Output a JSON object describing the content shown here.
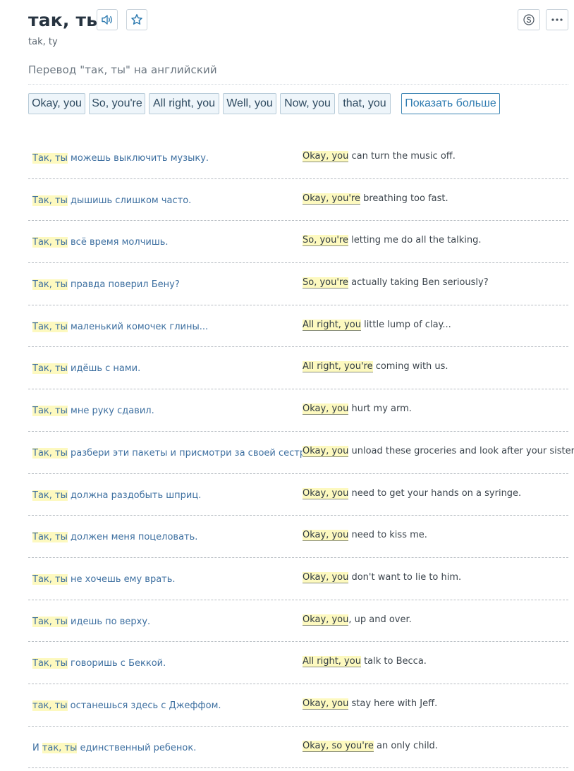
{
  "header": {
    "title": "так, ты",
    "transliteration": "tak, ty"
  },
  "icons": {
    "speaker": "speaker-icon",
    "star": "star-icon",
    "skype": "skype-icon",
    "more": "more-dots-icon"
  },
  "colors": {
    "accent": "#2e7bb0",
    "highlight": "#fdf9bf",
    "chip_bg": "#eef5fa"
  },
  "section": {
    "title": "Перевод \"так, ты\" на английский"
  },
  "translations": [
    "Okay, you",
    "So, you're",
    "All right, you",
    "Well, you",
    "Now, you",
    "that, you"
  ],
  "show_more_label": "Показать больше",
  "examples": [
    {
      "src_pre": "",
      "src_hl": "Так, ты",
      "src_post": " можешь выключить музыку.",
      "tgt_hl": "Okay, you",
      "tgt_post": " can turn the music off."
    },
    {
      "src_pre": "",
      "src_hl": "Так, ты",
      "src_post": " дышишь слишком часто.",
      "tgt_hl": "Okay, you're",
      "tgt_post": " breathing too fast."
    },
    {
      "src_pre": "",
      "src_hl": "Так, ты",
      "src_post": " всё время молчишь.",
      "tgt_hl": "So, you're",
      "tgt_post": " letting me do all the talking."
    },
    {
      "src_pre": "",
      "src_hl": "Так, ты",
      "src_post": " правда поверил Бену?",
      "tgt_hl": "So, you're",
      "tgt_post": " actually taking Ben seriously?"
    },
    {
      "src_pre": "",
      "src_hl": "Так, ты",
      "src_post": " маленький комочек глины...",
      "tgt_hl": "All right, you",
      "tgt_post": " little lump of clay..."
    },
    {
      "src_pre": "",
      "src_hl": "Так, ты",
      "src_post": " идёшь с нами.",
      "tgt_hl": "All right, you're",
      "tgt_post": " coming with us."
    },
    {
      "src_pre": "",
      "src_hl": "Так, ты",
      "src_post": " мне руку сдавил.",
      "tgt_hl": "Okay, you",
      "tgt_post": " hurt my arm."
    },
    {
      "src_pre": "",
      "src_hl": "Так, ты",
      "src_post": " разбери эти пакеты и присмотри за своей сестрой.",
      "tgt_hl": "Okay, you",
      "tgt_post": " unload these groceries and look after your sister."
    },
    {
      "src_pre": "",
      "src_hl": "Так, ты",
      "src_post": " должна раздобыть шприц.",
      "tgt_hl": "Okay, you",
      "tgt_post": " need to get your hands on a syringe."
    },
    {
      "src_pre": "",
      "src_hl": "Так, ты",
      "src_post": " должен меня поцеловать.",
      "tgt_hl": "Okay, you",
      "tgt_post": " need to kiss me."
    },
    {
      "src_pre": "",
      "src_hl": "Так, ты",
      "src_post": " не хочешь ему врать.",
      "tgt_hl": "Okay, you",
      "tgt_post": " don't want to lie to him."
    },
    {
      "src_pre": "",
      "src_hl": "Так, ты",
      "src_post": " идешь по верху.",
      "tgt_hl": "Okay, you",
      "tgt_post": ", up and over."
    },
    {
      "src_pre": "",
      "src_hl": "Так, ты",
      "src_post": " говоришь с Беккой.",
      "tgt_hl": "All right, you",
      "tgt_post": " talk to Becca."
    },
    {
      "src_pre": "",
      "src_hl": "так, ты",
      "src_post": " останешься здесь с Джеффом.",
      "tgt_hl": "Okay, you",
      "tgt_post": " stay here with Jeff."
    },
    {
      "src_pre": "И ",
      "src_hl": "так, ты",
      "src_post": " единственный ребенок.",
      "tgt_hl": "Okay, so you're",
      "tgt_post": " an only child."
    }
  ]
}
